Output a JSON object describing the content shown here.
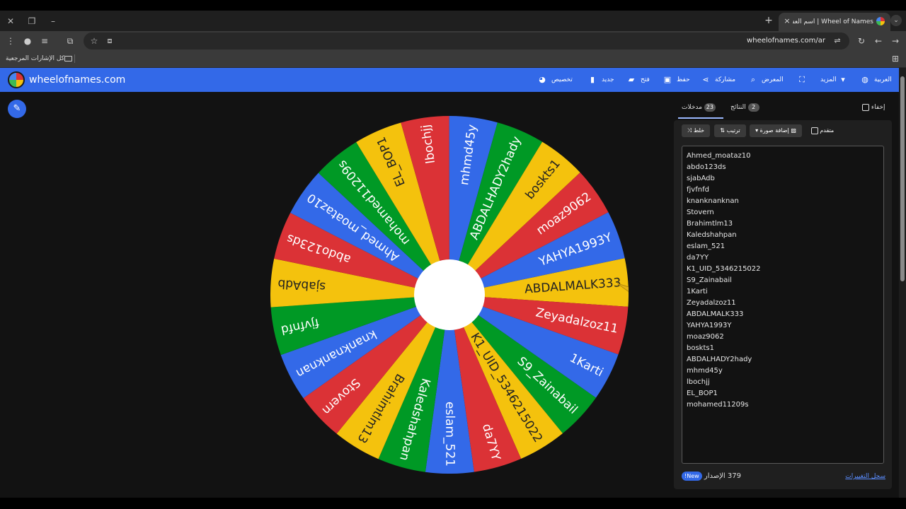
{
  "browser": {
    "tab_title": "Wheel of Names | اسم العشوائي",
    "tab_close_icon": "×",
    "new_tab_icon": "+",
    "url": "wheelofnames.com/ar",
    "bookmarks_all": "كل الإشارات المرجعية"
  },
  "header": {
    "logo_text": "wheelofnames.com",
    "menu": {
      "customize": "تخصيص",
      "new": "جديد",
      "open": "فتح",
      "save": "حفظ",
      "share": "مشاركة",
      "gallery": "المعرض",
      "more": "المزيد",
      "language": "العربية"
    }
  },
  "wheel": {
    "colors": [
      "#f4c20d",
      "#db3236",
      "#3369e8",
      "#009925"
    ],
    "segments": [
      "ABDALMALK333",
      "Zeyadalzoz11",
      "1Karti",
      "S9_Zainabail",
      "K1_UID_5346215022",
      "da7YY",
      "eslam_521",
      "Kaledshahpan",
      "Brahimtlm13",
      "Stovern",
      "knanknanknan",
      "fjvfnfd",
      "sjabAdb",
      "abdo123ds",
      "Ahmed_moataz10",
      "mohamed11209s",
      "EL_BOP1",
      "lbochjj",
      "mhmd45y",
      "ABDALHADY2hady",
      "boskts1",
      "moaz9062",
      "YAHYA1993Y"
    ]
  },
  "panel": {
    "tabs": {
      "entries_label": "مدخلات",
      "entries_count": "23",
      "results_label": "النتائج",
      "results_count": "2",
      "hide_label": "إخفاء"
    },
    "buttons": {
      "shuffle": "خلط",
      "sort": "ترتيب",
      "add_image": "إضافة صورة",
      "advanced": "متقدم"
    },
    "entries": [
      "Ahmed_moataz10",
      "abdo123ds",
      "sjabAdb",
      "fjvfnfd",
      "knanknanknan",
      "Stovern",
      "Brahimtlm13",
      "Kaledshahpan",
      "eslam_521",
      "da7YY",
      "K1_UID_5346215022",
      "S9_Zainabail",
      "1Karti",
      "Zeyadalzoz11",
      "ABDALMALK333",
      "YAHYA1993Y",
      "moaz9062",
      "boskts1",
      "ABDALHADY2hady",
      "mhmd45y",
      "lbochjj",
      "EL_BOP1",
      "mohamed11209s"
    ],
    "version_label": "الإصدار",
    "version_number": "379",
    "new_badge": "New!",
    "changelog": "سجل التغييرات"
  }
}
